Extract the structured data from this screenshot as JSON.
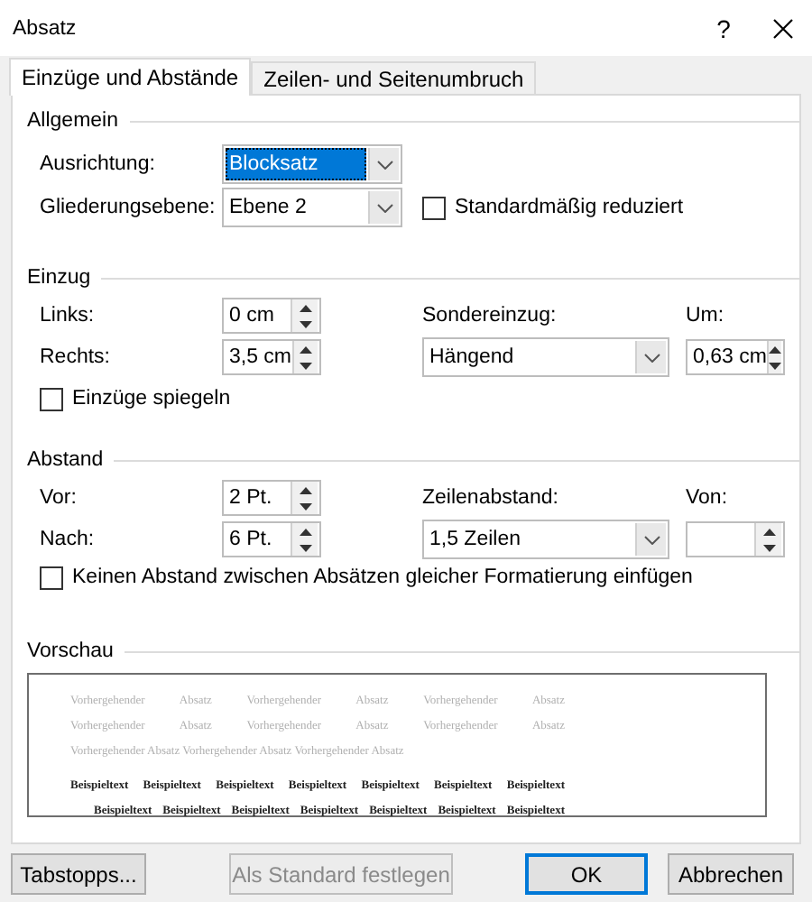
{
  "window": {
    "title": "Absatz",
    "help": "?"
  },
  "tabs": [
    {
      "label": "Einzüge und Abstände",
      "selected": true
    },
    {
      "label": "Zeilen- und Seitenumbruch",
      "selected": false
    }
  ],
  "general": {
    "title": "Allgemein",
    "alignment": {
      "label": "Ausrichtung:",
      "value": "Blocksatz",
      "focused": true
    },
    "outline_level": {
      "label": "Gliederungsebene:",
      "value": "Ebene 2",
      "focused": false
    },
    "collapsed_by_default": {
      "label": "Standardmäßig reduziert",
      "checked": false
    }
  },
  "indentation": {
    "title": "Einzug",
    "left": {
      "label": "Links:",
      "value": "0 cm"
    },
    "right": {
      "label": "Rechts:",
      "value": "3,5 cm"
    },
    "special": {
      "label": "Sondereinzug:",
      "value": "Hängend"
    },
    "by": {
      "label": "Um:",
      "value": "0,63 cm"
    },
    "mirror": {
      "label": "Einzüge spiegeln",
      "checked": false
    }
  },
  "spacing": {
    "title": "Abstand",
    "before": {
      "label": "Vor:",
      "value": "2 Pt."
    },
    "after": {
      "label": "Nach:",
      "value": "6 Pt."
    },
    "line_spacing": {
      "label": "Zeilenabstand:",
      "value": "1,5 Zeilen"
    },
    "at": {
      "label": "Von:"
    },
    "no_space_same_style": {
      "label": "Keinen Abstand zwischen Absätzen gleicher Formatierung einfügen",
      "checked": false
    }
  },
  "preview": {
    "title": "Vorschau",
    "previous_lines": [
      "Vorhergehender Absatz Vorhergehender Absatz Vorhergehender Absatz",
      "Vorhergehender Absatz Vorhergehender Absatz Vorhergehender Absatz",
      "Vorhergehender Absatz Vorhergehender Absatz Vorhergehender Absatz"
    ],
    "sample_lines": [
      "Beispieltext Beispieltext Beispieltext Beispieltext Beispieltext Beispieltext Beispieltext",
      "Beispieltext Beispieltext Beispieltext Beispieltext Beispieltext Beispieltext Beispieltext"
    ]
  },
  "buttons": [
    {
      "label": "Tabstopps...",
      "disabled": false,
      "default": false
    },
    {
      "label": "Als Standard festlegen",
      "disabled": true,
      "default": false
    },
    {
      "label": "OK",
      "disabled": false,
      "default": true
    },
    {
      "label": "Abbrechen",
      "disabled": false,
      "default": false
    }
  ]
}
